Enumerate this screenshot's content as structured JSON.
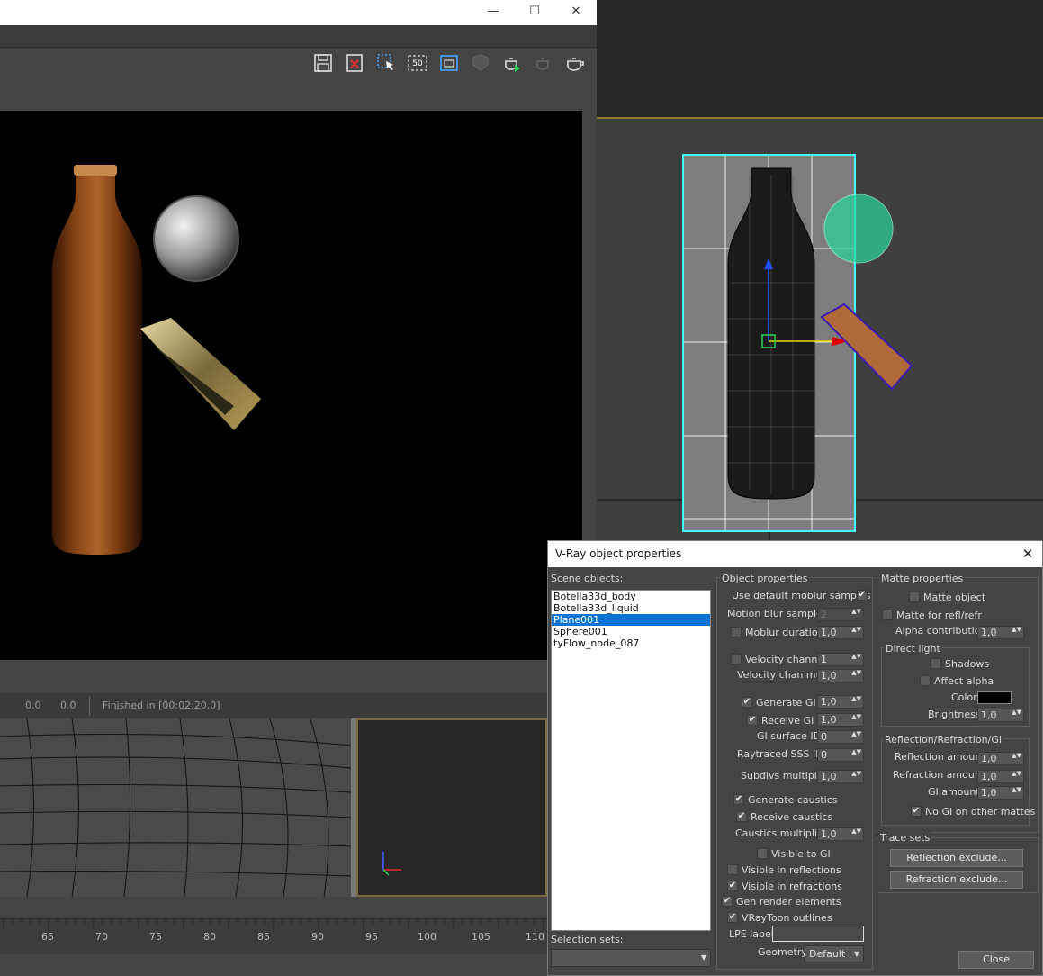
{
  "framebuffer": {
    "window_controls": {
      "minimize": "—",
      "maximize": "☐",
      "close": "✕"
    },
    "toolbar_icons": [
      "save-icon",
      "clear-image-icon",
      "region-select-icon",
      "zoom-50-icon",
      "track-mouse-icon",
      "render-stamp-icon",
      "render-last-icon",
      "render-interactive-icon",
      "render-icon"
    ],
    "zoom_label": "50",
    "status": {
      "val1": "0.0",
      "val2": "0.0",
      "finished": "Finished in [00:02:20,0]"
    }
  },
  "timeline": {
    "ticks": [
      "65",
      "70",
      "75",
      "80",
      "85",
      "90",
      "95",
      "100",
      "105",
      "110"
    ]
  },
  "dialog": {
    "title": "V-Ray object properties",
    "scene_objects_label": "Scene objects:",
    "scene_objects": [
      "Botella33d_body",
      "Botella33d_liquid",
      "Plane001",
      "Sphere001",
      "tyFlow_node_087"
    ],
    "selected_index": 2,
    "selection_sets_label": "Selection sets:",
    "object_properties": {
      "title": "Object properties",
      "use_default_moblur": "Use default moblur samples",
      "motion_blur_samples": "Motion blur samples",
      "motion_blur_samples_value": "2",
      "moblur_duration": "Moblur duration",
      "moblur_duration_value": "1,0",
      "velocity_channel": "Velocity channel",
      "velocity_channel_value": "1",
      "velocity_chan_mult": "Velocity chan mult",
      "velocity_chan_mult_value": "1,0",
      "generate_gi": "Generate GI",
      "generate_gi_value": "1,0",
      "receive_gi": "Receive GI",
      "receive_gi_value": "1,0",
      "gi_surface_id": "GI surface ID",
      "gi_surface_id_value": "0",
      "raytraced_sss_id": "Raytraced SSS ID",
      "raytraced_sss_id_value": "0",
      "subdivs_multiplier": "Subdivs multiplier",
      "subdivs_multiplier_value": "1,0",
      "generate_caustics": "Generate caustics",
      "receive_caustics": "Receive caustics",
      "caustics_multiplier": "Caustics multiplier",
      "caustics_multiplier_value": "1,0",
      "visible_to_gi": "Visible to GI",
      "visible_in_reflections": "Visible in reflections",
      "visible_in_refractions": "Visible in refractions",
      "gen_render_elements": "Gen render elements",
      "vraytoon_outlines": "VRayToon outlines",
      "lpe_label": "LPE label",
      "geometry": "Geometry",
      "geometry_value": "Default"
    },
    "matte_properties": {
      "title": "Matte properties",
      "matte_object": "Matte object",
      "matte_for_refl_refr": "Matte for refl/refr",
      "alpha_contribution": "Alpha contribution",
      "alpha_contribution_value": "1,0",
      "direct_light": "Direct light",
      "shadows": "Shadows",
      "affect_alpha": "Affect alpha",
      "color": "Color",
      "color_value": "#000000",
      "brightness": "Brightness",
      "brightness_value": "1,0",
      "rrgi": "Reflection/Refraction/GI",
      "reflection_amount": "Reflection amount",
      "reflection_amount_value": "1,0",
      "refraction_amount": "Refraction amount",
      "refraction_amount_value": "1,0",
      "gi_amount": "GI amount",
      "gi_amount_value": "1,0",
      "no_gi_on_other_mattes": "No GI on other mattes"
    },
    "trace_sets": {
      "title": "Trace sets",
      "reflection_exclude": "Reflection exclude...",
      "refraction_exclude": "Refraction exclude..."
    },
    "close_button": "Close",
    "checkmark": "✔",
    "spinner_arrows": "▲▼",
    "dropdown_arrow": "▼"
  }
}
